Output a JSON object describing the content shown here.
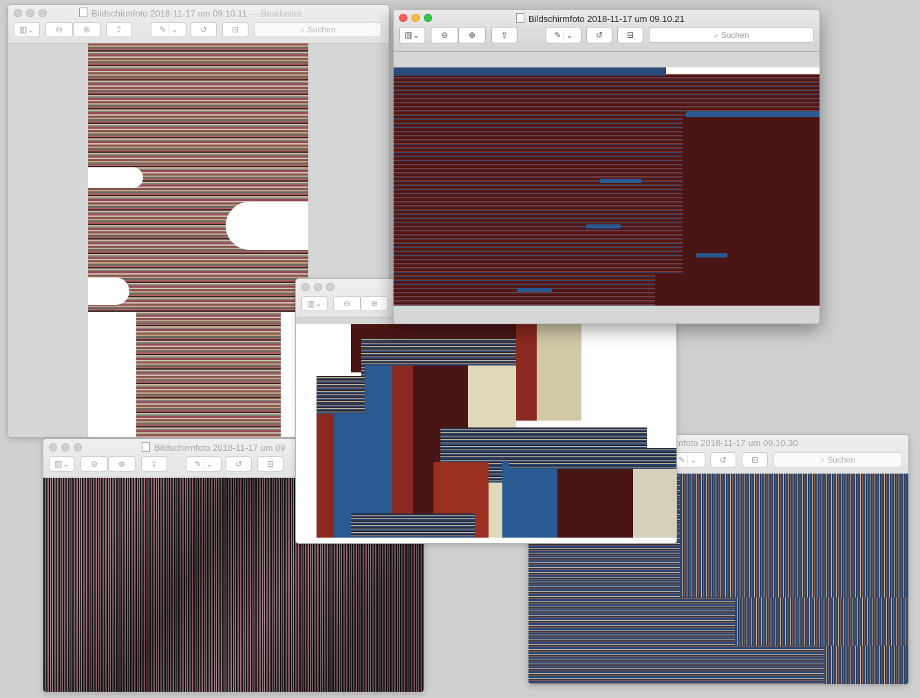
{
  "windows": {
    "w1": {
      "title": "Bildschirmfoto 2018-11-17 um 09.10.11",
      "separator": "—",
      "status": "Bearbeitet",
      "search_placeholder": "Suchen"
    },
    "w2": {
      "title": "Bildschirmfoto 2018-11-17 um 09.10.21",
      "search_placeholder": "Suchen"
    },
    "w3": {
      "title": "Bildschirmfoto 2018-11-17 um 09"
    },
    "w4": {
      "title": "mfoto 2018-11-17 um 09.10.30",
      "search_placeholder": "Suchen"
    },
    "w5": {
      "title": ""
    }
  },
  "icons": {
    "sidebar": "▥",
    "chevron": "⌄",
    "zoom_out": "⊖",
    "zoom_in": "⊕",
    "share": "⇪",
    "markup": "✎",
    "rotate": "↺",
    "toolbox": "⊟",
    "search": "⌕"
  },
  "colors": {
    "desktop": "#cfcfcf",
    "close": "#fc605c",
    "minimize": "#fdbc40",
    "zoom": "#34c84a",
    "art_maroon": "#4a1515",
    "art_blue": "#2a5a92",
    "art_tan": "#c9b78f",
    "art_rust": "#9a3a24"
  }
}
